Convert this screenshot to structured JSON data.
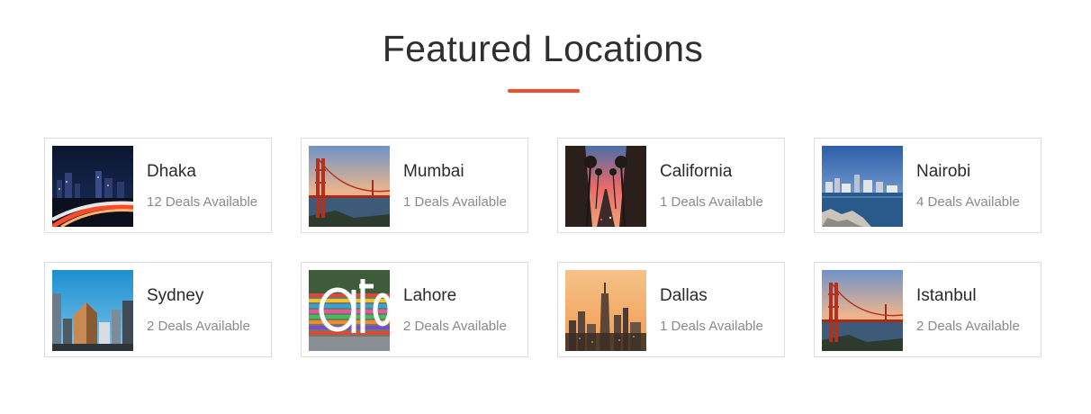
{
  "section": {
    "title": "Featured Locations",
    "accent_color": "#f04f2f"
  },
  "locations": [
    {
      "name": "Dhaka",
      "deals": "12 Deals Available",
      "image": "night-highway-city-photo"
    },
    {
      "name": "Mumbai",
      "deals": "1 Deals Available",
      "image": "golden-gate-bridge-photo"
    },
    {
      "name": "California",
      "deals": "1 Deals Available",
      "image": "palm-tree-street-sunset-photo"
    },
    {
      "name": "Nairobi",
      "deals": "4 Deals Available",
      "image": "harbor-skyline-photo"
    },
    {
      "name": "Sydney",
      "deals": "2 Deals Available",
      "image": "skyscrapers-blue-sky-photo"
    },
    {
      "name": "Lahore",
      "deals": "2 Deals Available",
      "image": "colorful-letters-sculpture-photo"
    },
    {
      "name": "Dallas",
      "deals": "1 Deals Available",
      "image": "city-skyline-sunset-photo"
    },
    {
      "name": "Istanbul",
      "deals": "2 Deals Available",
      "image": "golden-gate-bridge-photo"
    }
  ]
}
